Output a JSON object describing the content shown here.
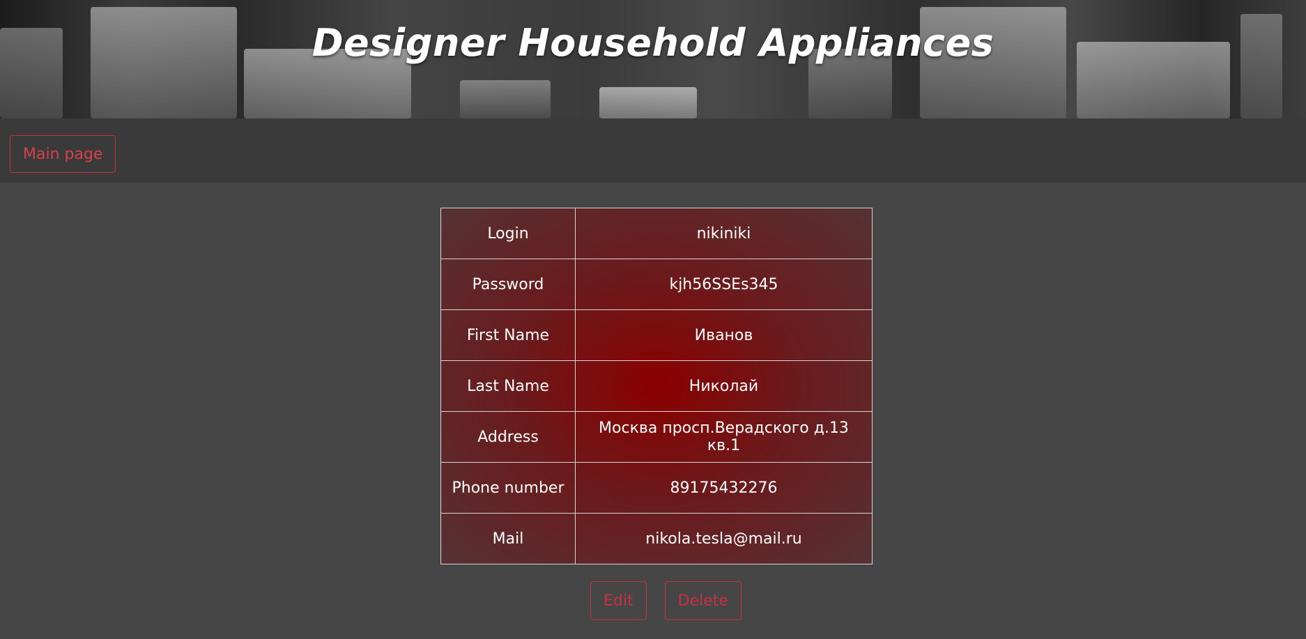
{
  "header": {
    "title": "Designer Household Appliances"
  },
  "nav": {
    "main_page_label": "Main page"
  },
  "profile": {
    "rows": [
      {
        "label": "Login",
        "value": "nikiniki"
      },
      {
        "label": "Password",
        "value": "kjh56SSEs345"
      },
      {
        "label": "First Name",
        "value": "Иванов"
      },
      {
        "label": "Last Name",
        "value": "Николай"
      },
      {
        "label": "Address",
        "value": "Москва просп.Верадского д.13 кв.1"
      },
      {
        "label": "Phone number",
        "value": "89175432276"
      },
      {
        "label": "Mail",
        "value": "nikola.tesla@mail.ru"
      }
    ]
  },
  "actions": {
    "edit_label": "Edit",
    "delete_label": "Delete"
  },
  "colors": {
    "accent": "#c8323f",
    "background": "#464646",
    "navbar": "#3a3a3a",
    "table_center": "#8b0000"
  }
}
